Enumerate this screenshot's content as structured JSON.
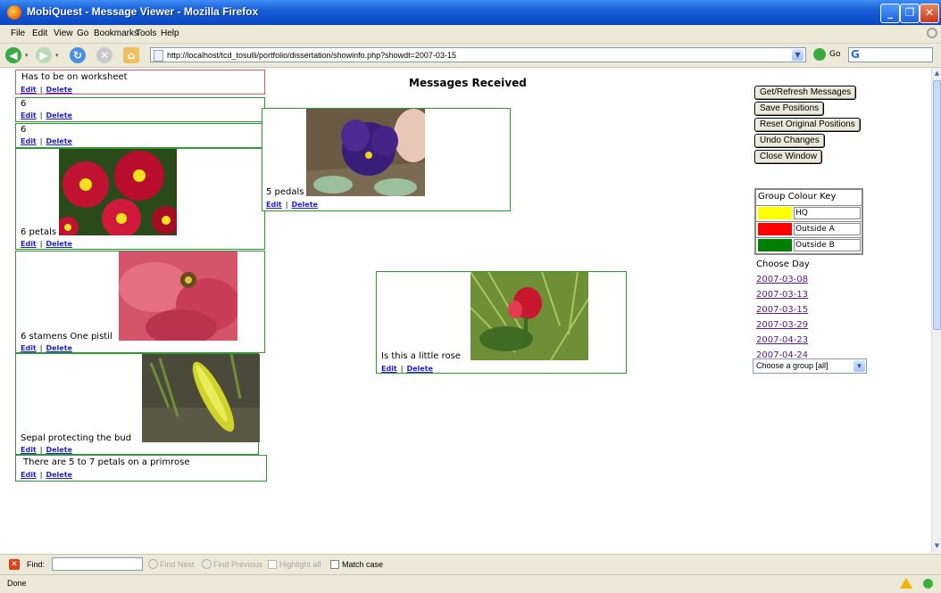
{
  "window": {
    "title": "MobiQuest - Message Viewer - Mozilla Firefox"
  },
  "menu": [
    "File",
    "Edit",
    "View",
    "Go",
    "Bookmarks",
    "Tools",
    "Help"
  ],
  "nav": {
    "url": "http://localhost/tcd_tosulli/portfolio/dissertation/showinfo.php?showdt=2007-03-15",
    "go_label": "Go",
    "search_logo": "G"
  },
  "page": {
    "heading": "Messages Received",
    "edit_label": "Edit",
    "delete_label": "Delete",
    "link_separator": "|",
    "messages": [
      {
        "text": "Has to be on worksheet",
        "group": "Outside A"
      },
      {
        "text": "6",
        "group": "Outside B"
      },
      {
        "text": "6",
        "group": "Outside B"
      },
      {
        "text": "6 petals",
        "group": "Outside B",
        "photo": "red-primrose"
      },
      {
        "text": "6 stamens One pistil",
        "group": "Outside B",
        "photo": "pink-tulip"
      },
      {
        "text": "Sepal protecting the bud",
        "group": "Outside B",
        "photo": "yellow-bud"
      },
      {
        "text": "There are 5 to 7 petals on a primrose",
        "group": "Outside B"
      },
      {
        "text": "5 pedals",
        "group": "Outside B",
        "photo": "purple-pansy"
      },
      {
        "text": "Is this a little rose",
        "group": "Outside B",
        "photo": "red-rosebud"
      }
    ],
    "buttons": {
      "refresh": "Get/Refresh Messages",
      "save": "Save Positions",
      "reset": "Reset Original Positions",
      "undo": "Undo Changes",
      "close": "Close Window"
    },
    "key": {
      "title": "Group Colour Key",
      "groups": [
        {
          "name": "HQ",
          "color": "#ffff00"
        },
        {
          "name": "Outside A",
          "color": "#ff0000"
        },
        {
          "name": "Outside B",
          "color": "#008000"
        }
      ]
    },
    "choose_day_label": "Choose Day",
    "days": [
      "2007-03-08",
      "2007-03-13",
      "2007-03-15",
      "2007-03-29",
      "2007-04-23",
      "2007-04-24"
    ],
    "group_select": {
      "selected": "Choose a group [all]"
    }
  },
  "findbar": {
    "find_label": "Find:",
    "find_next": "Find Next",
    "find_previous": "Find Previous",
    "highlight_all": "Highlight all",
    "match_case": "Match case"
  },
  "status": {
    "text": "Done"
  }
}
